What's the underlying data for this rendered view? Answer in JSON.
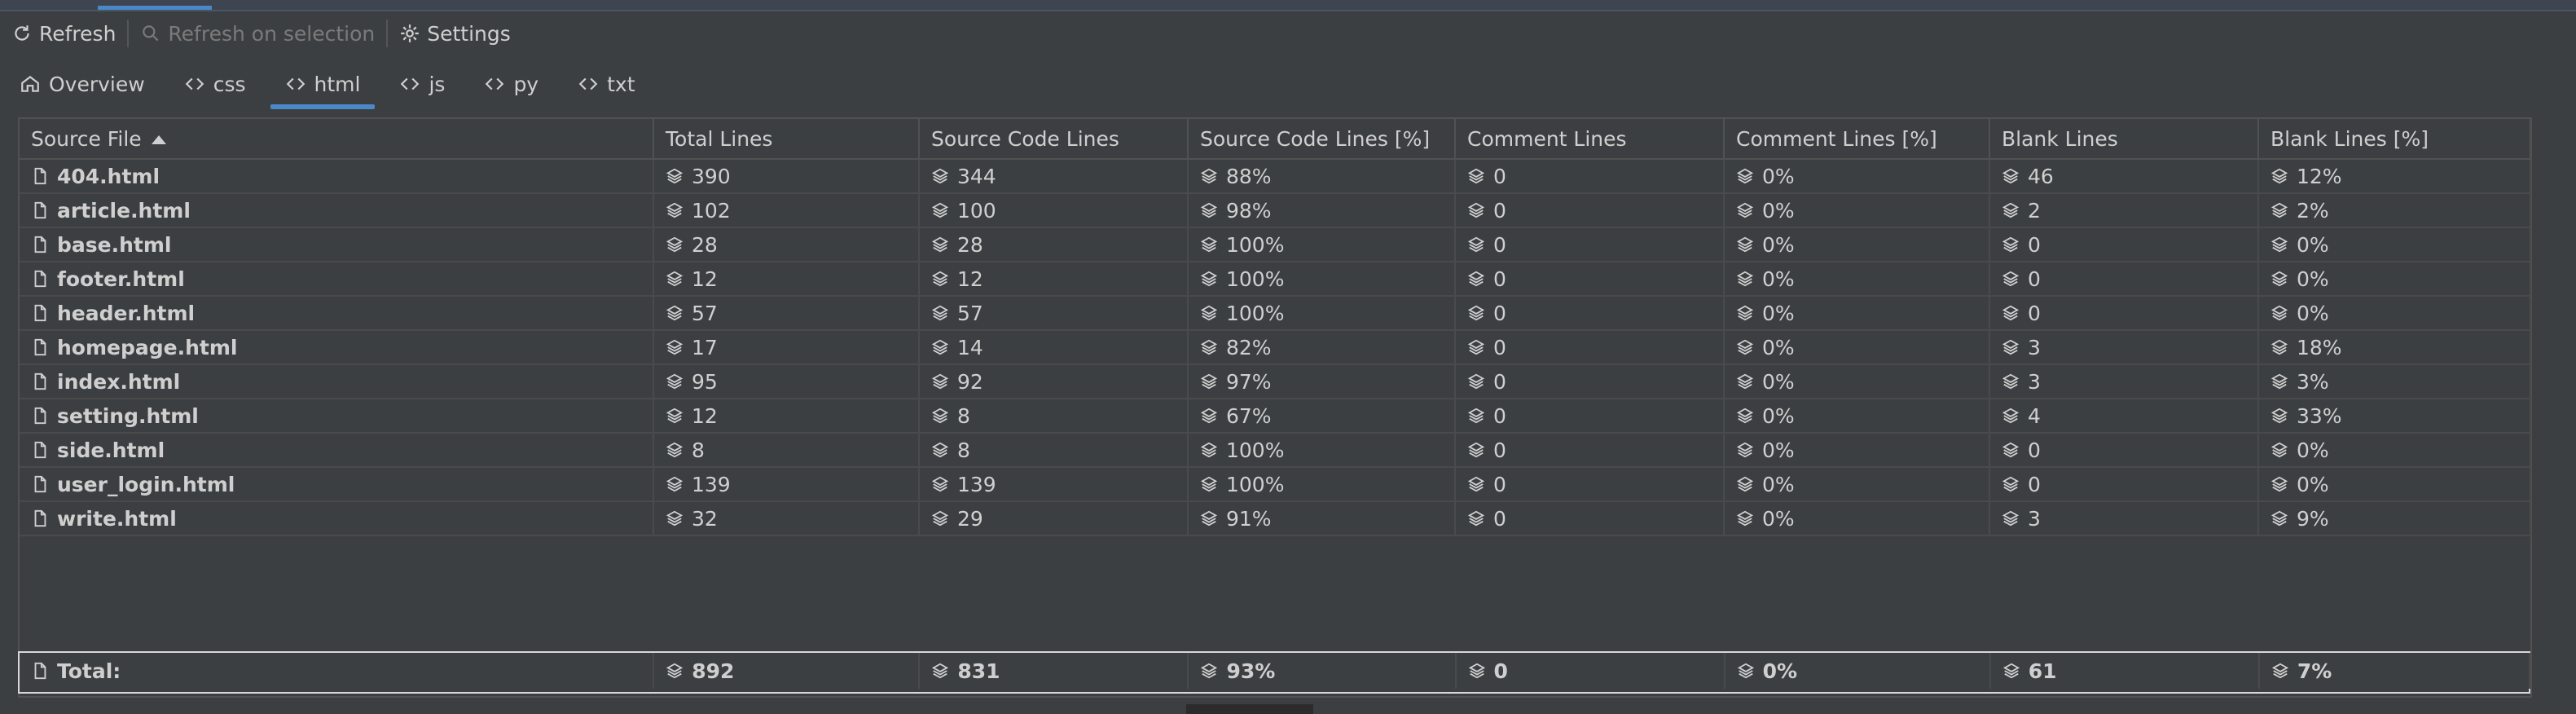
{
  "toolbar": {
    "refresh_label": "Refresh",
    "refresh_selection_label": "Refresh on selection",
    "settings_label": "Settings"
  },
  "tabs": [
    {
      "label": "Overview",
      "icon": "home-icon"
    },
    {
      "label": "css",
      "icon": "code-icon"
    },
    {
      "label": "html",
      "icon": "code-icon",
      "active": true
    },
    {
      "label": "js",
      "icon": "code-icon"
    },
    {
      "label": "py",
      "icon": "code-icon"
    },
    {
      "label": "txt",
      "icon": "code-icon"
    }
  ],
  "table": {
    "columns": [
      "Source File",
      "Total Lines",
      "Source Code Lines",
      "Source Code Lines [%]",
      "Comment Lines",
      "Comment Lines [%]",
      "Blank Lines",
      "Blank Lines [%]"
    ],
    "sort_column": "Source File",
    "sort_direction": "ascending",
    "rows": [
      [
        "404.html",
        "390",
        "344",
        "88%",
        "0",
        "0%",
        "46",
        "12%"
      ],
      [
        "article.html",
        "102",
        "100",
        "98%",
        "0",
        "0%",
        "2",
        "2%"
      ],
      [
        "base.html",
        "28",
        "28",
        "100%",
        "0",
        "0%",
        "0",
        "0%"
      ],
      [
        "footer.html",
        "12",
        "12",
        "100%",
        "0",
        "0%",
        "0",
        "0%"
      ],
      [
        "header.html",
        "57",
        "57",
        "100%",
        "0",
        "0%",
        "0",
        "0%"
      ],
      [
        "homepage.html",
        "17",
        "14",
        "82%",
        "0",
        "0%",
        "3",
        "18%"
      ],
      [
        "index.html",
        "95",
        "92",
        "97%",
        "0",
        "0%",
        "3",
        "3%"
      ],
      [
        "setting.html",
        "12",
        "8",
        "67%",
        "0",
        "0%",
        "4",
        "33%"
      ],
      [
        "side.html",
        "8",
        "8",
        "100%",
        "0",
        "0%",
        "0",
        "0%"
      ],
      [
        "user_login.html",
        "139",
        "139",
        "100%",
        "0",
        "0%",
        "0",
        "0%"
      ],
      [
        "write.html",
        "32",
        "29",
        "91%",
        "0",
        "0%",
        "3",
        "9%"
      ]
    ],
    "total": [
      "Total:",
      "892",
      "831",
      "93%",
      "0",
      "0%",
      "61",
      "7%"
    ]
  },
  "colors": {
    "background": "#3c3f41",
    "accent": "#4a88c7",
    "text": "#cfcfcf",
    "grid": "#515151"
  }
}
